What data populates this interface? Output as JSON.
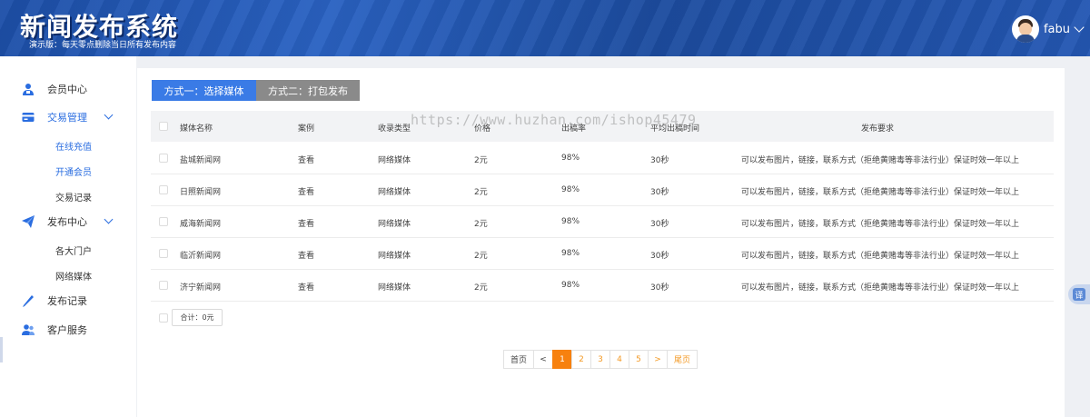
{
  "header": {
    "title": "新闻发布系统",
    "subtitle": "演示版：每天零点删除当日所有发布内容",
    "username": "fabu"
  },
  "sidebar": {
    "items": [
      {
        "label": "会员中心",
        "icon": "user-icon"
      },
      {
        "label": "交易管理",
        "icon": "card-icon"
      },
      {
        "label": "发布中心",
        "icon": "paper-plane-icon"
      },
      {
        "label": "发布记录",
        "icon": "pencil-icon"
      },
      {
        "label": "客户服务",
        "icon": "people-icon"
      }
    ],
    "trade_sub": [
      "在线充值",
      "开通会员",
      "交易记录"
    ],
    "publish_sub": [
      "各大门户",
      "网络媒体"
    ]
  },
  "tabs": [
    "方式一：选择媒体",
    "方式二：打包发布"
  ],
  "table": {
    "headers": [
      "媒体名称",
      "案例",
      "收录类型",
      "价格",
      "出稿率",
      "平均出稿时间",
      "发布要求"
    ],
    "rows": [
      {
        "name": "盐城新闻网",
        "case": "查看",
        "type": "网络媒体",
        "price": "2元",
        "rate": "98%",
        "time": "30秒",
        "req": "可以发布图片，链接，联系方式（拒绝黄赌毒等非法行业）保证时效一年以上"
      },
      {
        "name": "日照新闻网",
        "case": "查看",
        "type": "网络媒体",
        "price": "2元",
        "rate": "98%",
        "time": "30秒",
        "req": "可以发布图片，链接，联系方式（拒绝黄赌毒等非法行业）保证时效一年以上"
      },
      {
        "name": "威海新闻网",
        "case": "查看",
        "type": "网络媒体",
        "price": "2元",
        "rate": "98%",
        "time": "30秒",
        "req": "可以发布图片，链接，联系方式（拒绝黄赌毒等非法行业）保证时效一年以上"
      },
      {
        "name": "临沂新闻网",
        "case": "查看",
        "type": "网络媒体",
        "price": "2元",
        "rate": "98%",
        "time": "30秒",
        "req": "可以发布图片，链接，联系方式（拒绝黄赌毒等非法行业）保证时效一年以上"
      },
      {
        "name": "济宁新闻网",
        "case": "查看",
        "type": "网络媒体",
        "price": "2元",
        "rate": "98%",
        "time": "30秒",
        "req": "可以发布图片，链接，联系方式（拒绝黄赌毒等非法行业）保证时效一年以上"
      }
    ],
    "total": "合计：0元"
  },
  "pagination": {
    "first": "首页",
    "prev": "<",
    "pages": [
      "1",
      "2",
      "3",
      "4",
      "5"
    ],
    "current": "1",
    "next": ">",
    "last": "尾页"
  },
  "watermark": "https://www.huzhan.com/ishop45479",
  "translate_label": "译",
  "colors": {
    "header_blue": "#2457b3",
    "accent_blue": "#2a6de0",
    "tab_active": "#3a7be6",
    "tab_inactive": "#8a8a8a",
    "page_active": "#f7810f"
  }
}
